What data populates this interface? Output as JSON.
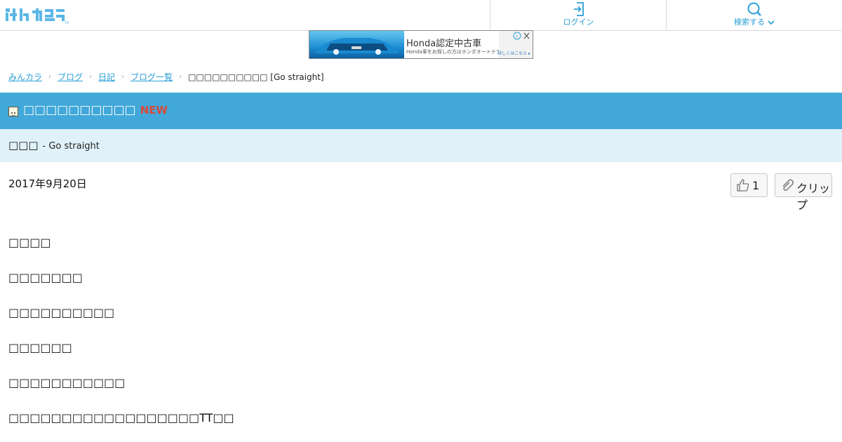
{
  "header": {
    "login_label": "ログイン",
    "search_label": "検索する"
  },
  "ad": {
    "title": "Honda認定中古車",
    "subtitle": "Honda車をお探しの方はホンダオートテラスへ",
    "cta": "詳しくはこちら ▸"
  },
  "breadcrumb": {
    "items": [
      "みんカラ",
      "ブログ",
      "日記",
      "ブログ一覧"
    ],
    "current": "□□□□□□□□□□ [Go straight]"
  },
  "title": {
    "text": "□□□□□□□□□□",
    "badge": "NEW"
  },
  "author": {
    "name": "□□□",
    "blog": "- Go straight"
  },
  "post": {
    "date": "2017年9月20日",
    "like_count": "1",
    "clip_label": "クリップ"
  },
  "body": {
    "lines": [
      "□□□□",
      "□□□□□□□",
      "□□□□□□□□□□",
      "□□□□□□",
      "□□□□□□□□□□□",
      "□□□□□□□□□□□□□□□□□□TT□□"
    ]
  },
  "colors": {
    "accent": "#42a8d9",
    "link": "#2a9fd6",
    "author_bg": "#e1f1f9",
    "new_badge": "#d94a3a"
  }
}
